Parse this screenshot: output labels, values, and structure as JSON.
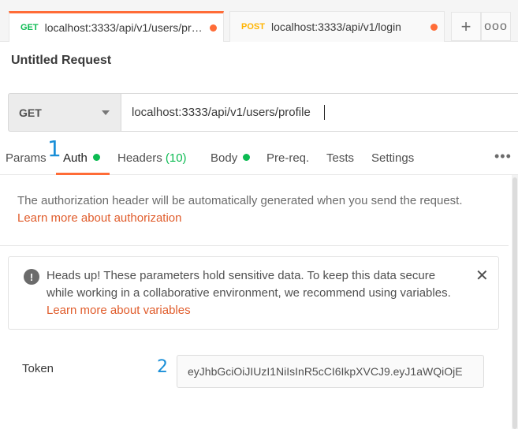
{
  "tabs": [
    {
      "method": "GET",
      "title": "localhost:3333/api/v1/users/profile",
      "unsaved": true,
      "active": true
    },
    {
      "method": "POST",
      "title": "localhost:3333/api/v1/login",
      "unsaved": true,
      "active": false
    }
  ],
  "tab_actions": {
    "add_icon": "plus-icon",
    "add_label": "+",
    "more_icon": "ellipsis-icon",
    "more_label": "ooo"
  },
  "request": {
    "title": "Untitled Request",
    "method": "GET",
    "url": "localhost:3333/api/v1/users/profile"
  },
  "subtabs": {
    "params": "Params",
    "auth": "Auth",
    "headers": "Headers",
    "headers_count": "(10)",
    "body": "Body",
    "prereq": "Pre-req.",
    "tests": "Tests",
    "settings": "Settings",
    "more_label": "•••"
  },
  "annotations": {
    "marker_1": "1",
    "marker_2": "2"
  },
  "auth": {
    "info_text": "The authorization header will be automatically generated when you send the request.",
    "info_link": "Learn more about authorization",
    "alert_text": "Heads up! These parameters hold sensitive data. To keep this data secure while working in a collaborative environment, we recommend using variables.",
    "alert_link": "Learn more about variables",
    "alert_icon_label": "!",
    "close_label": "✕",
    "token_label": "Token",
    "token_value": "eyJhbGciOiJIUzI1NiIsInR5cCI6IkpXVCJ9.eyJ1aWQiOjE"
  },
  "colors": {
    "accent": "#ff6c37",
    "get": "#0cbb52",
    "post": "#ffb400",
    "link": "#e05c2b",
    "marker": "#1a8fd8"
  }
}
